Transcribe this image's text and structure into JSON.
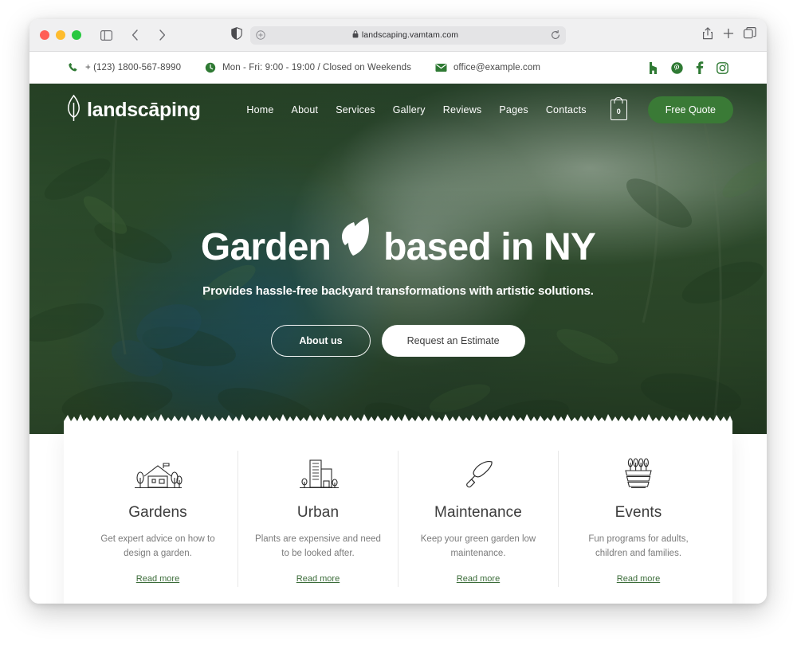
{
  "browser": {
    "url": "landscaping.vamtam.com",
    "lock_icon": "lock-icon",
    "shield_icon": "shield-icon",
    "reload_icon": "reload-icon",
    "sidebar_icon": "sidebar-icon",
    "back_icon": "chevron-left-icon",
    "forward_icon": "chevron-right-icon",
    "share_icon": "share-icon",
    "newtab_icon": "plus-icon",
    "tabs_icon": "tabs-overview-icon"
  },
  "infobar": {
    "phone": "+ (123) 1800-567-8990",
    "hours": "Mon - Fri: 9:00 - 19:00 / Closed on Weekends",
    "email": "office@example.com",
    "phone_icon": "phone-icon",
    "clock_icon": "clock-icon",
    "mail_icon": "envelope-icon",
    "socials": [
      {
        "name": "houzz-icon",
        "glyph": "houzz"
      },
      {
        "name": "pinterest-icon",
        "glyph": "pinterest"
      },
      {
        "name": "facebook-icon",
        "glyph": "facebook"
      },
      {
        "name": "instagram-icon",
        "glyph": "instagram"
      }
    ]
  },
  "header": {
    "logo_text": "landscāping",
    "logo_icon": "leaf-logo-icon",
    "menu": [
      {
        "label": "Home"
      },
      {
        "label": "About"
      },
      {
        "label": "Services"
      },
      {
        "label": "Gallery"
      },
      {
        "label": "Reviews"
      },
      {
        "label": "Pages"
      },
      {
        "label": "Contacts"
      }
    ],
    "cart_count": "0",
    "cart_icon": "shopping-bag-icon",
    "quote_button": "Free Quote",
    "accent_color": "#3a7a36"
  },
  "hero": {
    "headline_left": "Garden",
    "headline_right": "based in NY",
    "leaf_icon": "leaf-icon",
    "subhead": "Provides hassle-free backyard transformations with artistic solutions.",
    "btn_primary": "About us",
    "btn_secondary": "Request an Estimate"
  },
  "services": [
    {
      "icon": "garden-house-icon",
      "title": "Gardens",
      "desc": "Get expert advice on how to design a garden.",
      "link": "Read more"
    },
    {
      "icon": "city-building-icon",
      "title": "Urban",
      "desc": "Plants are expensive and need to be looked after.",
      "link": "Read more"
    },
    {
      "icon": "trowel-icon",
      "title": "Maintenance",
      "desc": "Keep your green garden low maintenance.",
      "link": "Read more"
    },
    {
      "icon": "planter-box-icon",
      "title": "Events",
      "desc": "Fun programs for adults, children and families.",
      "link": "Read more"
    }
  ]
}
